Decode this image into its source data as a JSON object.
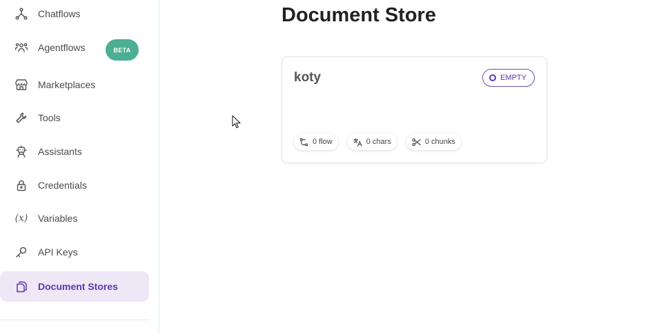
{
  "sidebar": {
    "items": [
      {
        "label": "Chatflows",
        "icon": "chatflows-icon"
      },
      {
        "label": "Agentflows",
        "icon": "agentflows-icon",
        "badge": "BETA"
      },
      {
        "label": "Marketplaces",
        "icon": "marketplace-icon"
      },
      {
        "label": "Tools",
        "icon": "tools-icon"
      },
      {
        "label": "Assistants",
        "icon": "assistants-icon"
      },
      {
        "label": "Credentials",
        "icon": "lock-icon"
      },
      {
        "label": "Variables",
        "icon": "variable-icon",
        "icon_text": "(x)"
      },
      {
        "label": "API Keys",
        "icon": "key-icon"
      },
      {
        "label": "Document Stores",
        "icon": "document-stores-icon",
        "active": true
      }
    ]
  },
  "main": {
    "title": "Document Store",
    "cards": [
      {
        "name": "koty",
        "status": "EMPTY",
        "stats": {
          "flows": "0 flow",
          "chars": "0 chars",
          "chunks": "0 chunks"
        }
      }
    ]
  },
  "colors": {
    "accent": "#5e35b1",
    "active_bg": "#ede7f6",
    "beta_badge": "#4caf93"
  }
}
